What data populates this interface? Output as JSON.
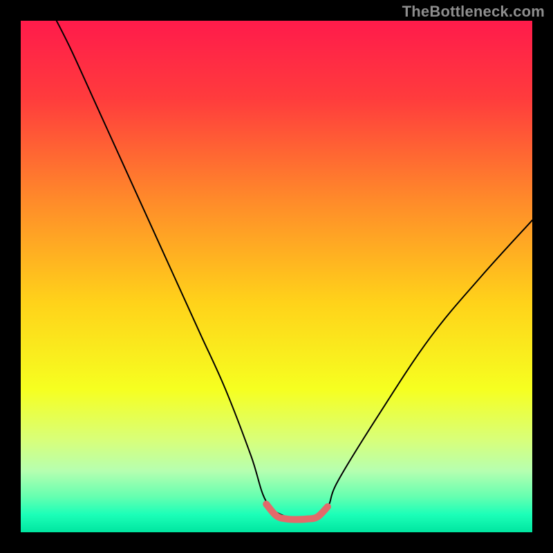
{
  "watermark": {
    "text": "TheBottleneck.com"
  },
  "chart_data": {
    "type": "line",
    "title": "",
    "xlabel": "",
    "ylabel": "",
    "xlim": [
      0,
      100
    ],
    "ylim": [
      0,
      100
    ],
    "grid": false,
    "legend": false,
    "annotations": [],
    "background_gradient": [
      {
        "pos": 0.0,
        "color": "#ff1b4b"
      },
      {
        "pos": 0.15,
        "color": "#ff3b3d"
      },
      {
        "pos": 0.35,
        "color": "#ff8a2a"
      },
      {
        "pos": 0.55,
        "color": "#ffd21a"
      },
      {
        "pos": 0.72,
        "color": "#f6ff20"
      },
      {
        "pos": 0.82,
        "color": "#d8ff7a"
      },
      {
        "pos": 0.88,
        "color": "#b6ffb0"
      },
      {
        "pos": 0.93,
        "color": "#66ffb0"
      },
      {
        "pos": 0.965,
        "color": "#1cffb8"
      },
      {
        "pos": 1.0,
        "color": "#00e6a0"
      }
    ],
    "series": [
      {
        "name": "bottleneck-curve",
        "color": "#000000",
        "width": 2,
        "x": [
          7,
          10,
          15,
          20,
          25,
          30,
          35,
          40,
          45,
          48,
          52,
          55,
          57,
          60,
          62,
          70,
          80,
          90,
          100
        ],
        "y": [
          100,
          94,
          83,
          72,
          61,
          50,
          39,
          28,
          15,
          6,
          3,
          3,
          3,
          5,
          10,
          23,
          38,
          50,
          61
        ]
      },
      {
        "name": "optimal-band",
        "color": "#e26a6a",
        "width": 10,
        "x": [
          48,
          50,
          52,
          54,
          56,
          58,
          60
        ],
        "y": [
          5.5,
          3.2,
          2.6,
          2.5,
          2.6,
          3.0,
          5.0
        ]
      }
    ]
  }
}
